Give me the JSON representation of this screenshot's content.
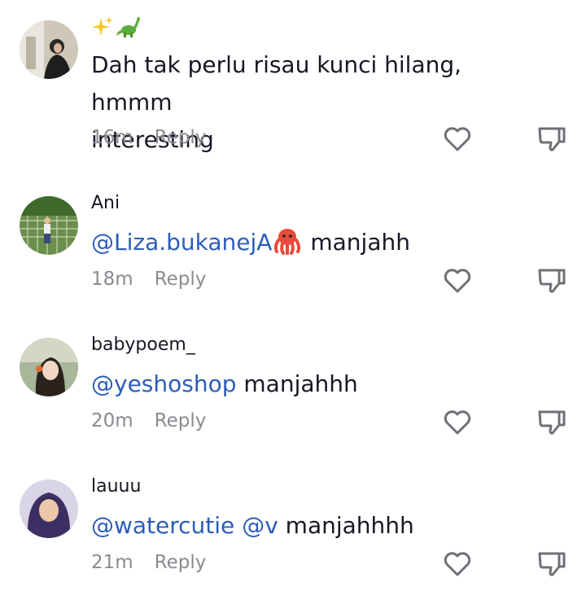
{
  "comments": [
    {
      "username": "",
      "name_emojis": [
        "sparkles",
        "sauropod"
      ],
      "line1": "Dah tak perlu risau kunci hilang, hmmm",
      "line2": "interesting",
      "time": "16m",
      "reply_label": "Reply"
    },
    {
      "username": "Ani",
      "mention1": "@Liza.bukanejA",
      "emoji": "octopus",
      "text": " manjahh",
      "time": "18m",
      "reply_label": "Reply"
    },
    {
      "username": "babypoem_",
      "mention1": "@yeshoshop",
      "text": " manjahhh",
      "time": "20m",
      "reply_label": "Reply"
    },
    {
      "username": "lauuu",
      "mention1": "@watercutie",
      "mention2": "@v",
      "text": " manjahhhh",
      "time": "21m",
      "reply_label": "Reply"
    }
  ],
  "icons": {
    "like": "heart-outline-icon",
    "dislike": "thumbs-down-outline-icon"
  },
  "colors": {
    "mention": "#2b5db9",
    "meta": "#8a8b91",
    "text": "#161823"
  }
}
